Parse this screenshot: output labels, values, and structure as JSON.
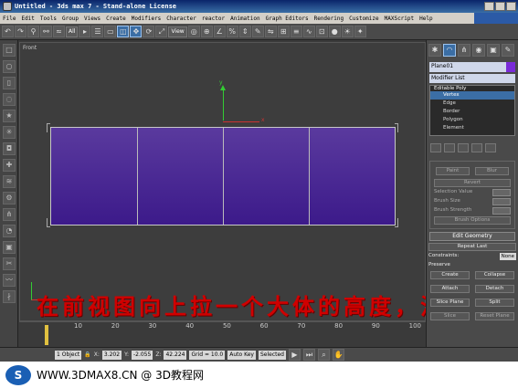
{
  "title_bar": {
    "title": "Untitled - 3ds max 7 - Stand-alone License"
  },
  "menu": [
    "File",
    "Edit",
    "Tools",
    "Group",
    "Views",
    "Create",
    "Modifiers",
    "Character",
    "reactor",
    "Animation",
    "Graph Editors",
    "Rendering",
    "Customize",
    "MAXScript",
    "Help"
  ],
  "toolbar": {
    "selection_filter": "All",
    "ref_coord": "View"
  },
  "viewport": {
    "label": "Front",
    "axis_x": "x",
    "axis_y": "y"
  },
  "overlay_text": "在前视图向上拉一个大体的高度，注意比例",
  "timeline": {
    "ticks": [
      "10",
      "20",
      "30",
      "40",
      "50",
      "60",
      "70",
      "80",
      "90",
      "100"
    ]
  },
  "command_panel": {
    "object_name": "Plane01",
    "modifier_list": "Modifier List",
    "stack": {
      "root": "Editable Poly",
      "items": [
        "Vertex",
        "Edge",
        "Border",
        "Polygon",
        "Element"
      ],
      "selected": "Vertex"
    },
    "rollout1": {
      "buttons": [
        "Paint",
        "Blur",
        "Revert"
      ],
      "rows": [
        "Selection Value",
        "Brush Size",
        "Brush Strength"
      ],
      "options": "Brush Options"
    },
    "edit_geometry": {
      "header": "Edit Geometry",
      "repeat_last": "Repeat Last",
      "constraints_label": "Constraints:",
      "constraints_value": "None",
      "preserve": "Preserve",
      "create": "Create",
      "collapse": "Collapse",
      "attach": "Attach",
      "detach": "Detach",
      "slice_plane": "Slice Plane",
      "split": "Split",
      "slice": "Slice",
      "reset_plane": "Reset Plane"
    }
  },
  "status": {
    "objects": "1 Object",
    "x_label": "X:",
    "x_value": "3.202",
    "y_label": "Y:",
    "y_value": "-2.055",
    "z_label": "Z:",
    "z_value": "42.224",
    "grid": "Grid = 10.0",
    "auto_key": "Auto Key",
    "key_mode": "Selected"
  },
  "watermark": {
    "text": "WWW.3DMAX8.CN @ 3D教程网"
  }
}
